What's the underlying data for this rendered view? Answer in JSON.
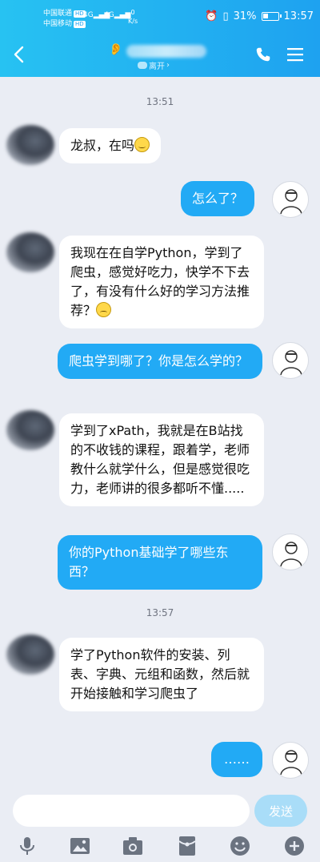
{
  "status_bar": {
    "carrier1": "中国联通",
    "carrier2": "中国移动",
    "hd": "HD",
    "signal1": "4G",
    "signal2": "4G",
    "net_speed": "0",
    "net_unit": "K/s",
    "battery": "31%",
    "time": "13:57"
  },
  "header": {
    "subtitle": "离开"
  },
  "messages": [
    {
      "type": "time",
      "text": "13:51"
    },
    {
      "side": "left",
      "text": "龙叔，在吗",
      "emoji": "smile"
    },
    {
      "side": "right",
      "text": "怎么了？"
    },
    {
      "side": "left",
      "text": "我现在在自学Python，学到了爬虫，感觉好吃力，快学不下去了，有没有什么好的学习方法推荐？",
      "emoji": "sad"
    },
    {
      "side": "right",
      "text": "爬虫学到哪了？你是怎么学的？"
    },
    {
      "side": "left",
      "text": "学到了xPath，我就是在B站找的不收钱的课程，跟着学，老师教什么就学什么，但是感觉很吃力，老师讲的很多都听不懂....."
    },
    {
      "side": "right",
      "text": "你的Python基础学了哪些东西？"
    },
    {
      "type": "time",
      "text": "13:57"
    },
    {
      "side": "left",
      "text": "学了Python软件的安装、列表、字典、元组和函数，然后就开始接触和学习爬虫了"
    },
    {
      "side": "right",
      "text": "……"
    }
  ],
  "input": {
    "value": "",
    "send_label": "发送"
  },
  "toolbar": {
    "icons": [
      "microphone-icon",
      "image-icon",
      "camera-icon",
      "red-packet-icon",
      "emoji-icon",
      "plus-icon"
    ]
  },
  "colors": {
    "header_start": "#27c2f2",
    "header_end": "#1ea2f0",
    "bubble_right": "#22aaf5",
    "bubble_left": "#ffffff",
    "background": "#eaedf4",
    "send_button": "#a9ddf8"
  }
}
